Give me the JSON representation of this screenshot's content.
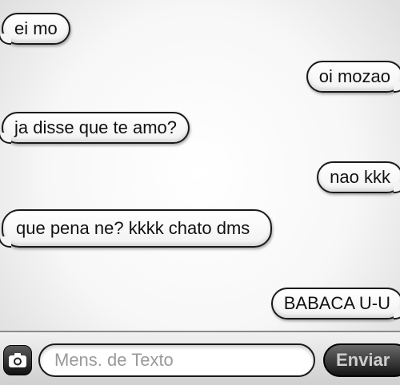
{
  "messages": [
    {
      "side": "received",
      "text": "ei mo"
    },
    {
      "side": "sent",
      "text": "oi mozao"
    },
    {
      "side": "received",
      "text": "ja disse que te amo?"
    },
    {
      "side": "sent",
      "text": "nao kkk"
    },
    {
      "side": "received",
      "text": "que pena ne? kkkk chato dms"
    },
    {
      "side": "sent",
      "text": "BABACA U-U"
    }
  ],
  "composer": {
    "placeholder": "Mens. de Texto",
    "value": "",
    "send_label": "Enviar",
    "camera_icon": "camera-icon"
  }
}
